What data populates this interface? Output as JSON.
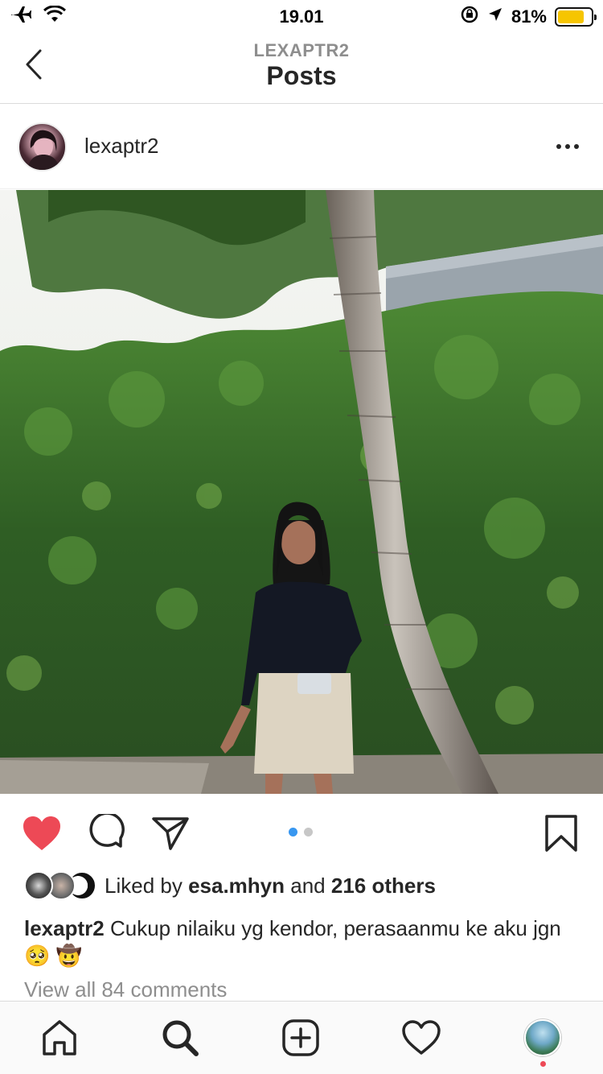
{
  "status_bar": {
    "time": "19.01",
    "battery_pct": "81%",
    "battery_level": 0.81
  },
  "nav": {
    "subtitle": "LEXAPTR2",
    "title": "Posts"
  },
  "post": {
    "username": "lexaptr2",
    "liked_by_prefix": "Liked by",
    "liked_by_user": "esa.mhyn",
    "liked_by_and": "and",
    "liked_by_others": "216 others",
    "caption_user": "lexaptr2",
    "caption_text": "Cukup nilaiku yg kendor, perasaanmu ke aku jgn🥺 🤠",
    "view_comments": "View all 84 comments",
    "carousel": {
      "count": 2,
      "active_index": 0
    },
    "liked": true
  },
  "tabs": [
    "home",
    "search",
    "new-post",
    "activity",
    "profile"
  ],
  "colors": {
    "like_red": "#ed4956",
    "accent_blue": "#3897f0",
    "battery_yellow": "#f6c500"
  }
}
